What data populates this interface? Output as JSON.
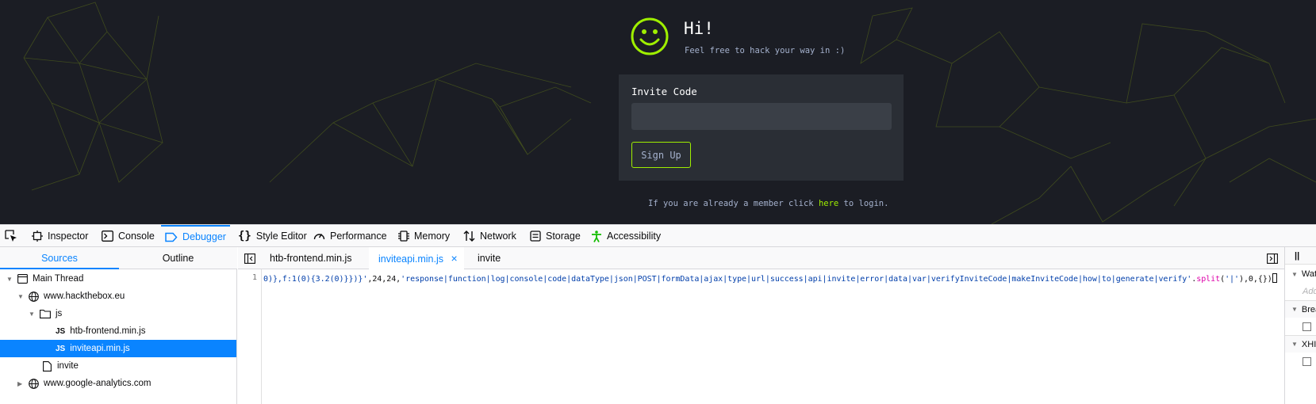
{
  "webpage": {
    "greeting": "Hi!",
    "subtitle": "Feel free to hack your way in :)",
    "invite_label": "Invite Code",
    "invite_value": "",
    "signup_label": "Sign Up",
    "member_prefix": "If you are already a member click ",
    "member_link": "here",
    "member_suffix": " to login.",
    "accent_color": "#9fef00",
    "background_color": "#1b1d24"
  },
  "devtools": {
    "tools": [
      {
        "label": "Inspector",
        "icon": "inspector-icon"
      },
      {
        "label": "Console",
        "icon": "console-icon"
      },
      {
        "label": "Debugger",
        "icon": "debugger-icon",
        "active": true
      },
      {
        "label": "Style Editor",
        "icon": "style-editor-icon"
      },
      {
        "label": "Performance",
        "icon": "performance-icon"
      },
      {
        "label": "Memory",
        "icon": "memory-icon"
      },
      {
        "label": "Network",
        "icon": "network-icon"
      },
      {
        "label": "Storage",
        "icon": "storage-icon"
      },
      {
        "label": "Accessibility",
        "icon": "accessibility-icon"
      }
    ],
    "sidebar": {
      "tabs": {
        "sources": "Sources",
        "outline": "Outline"
      },
      "tree": {
        "main_thread": "Main Thread",
        "domain1": "www.hackthebox.eu",
        "folder_js": "js",
        "file1": "htb-frontend.min.js",
        "file2": "inviteapi.min.js",
        "file3": "invite",
        "domain2": "www.google-analytics.com",
        "js_badge": "JS"
      }
    },
    "editor": {
      "tabs": {
        "tab1": "htb-frontend.min.js",
        "tab2": "inviteapi.min.js",
        "tab3": "invite"
      },
      "line_number": "1",
      "code": {
        "part1": "0)},f:1(0){3.2(0)}})}'",
        "part2": ",24,24,",
        "part3": "'response|function|log|console|code|dataType|json|POST|formData|ajax|type|url|success|api|invite|error|data|var|verifyInviteCode|makeInviteCode|how|to|generate|verify'",
        "part4": ".",
        "part5": "split",
        "part6": "(",
        "part7": "'|'",
        "part8": "),0,{})"
      }
    },
    "right_pane": {
      "watch_label": "Wat",
      "add_placeholder": "Add",
      "breakpoints_label": "Brea",
      "xhr_label": "XHI"
    }
  }
}
